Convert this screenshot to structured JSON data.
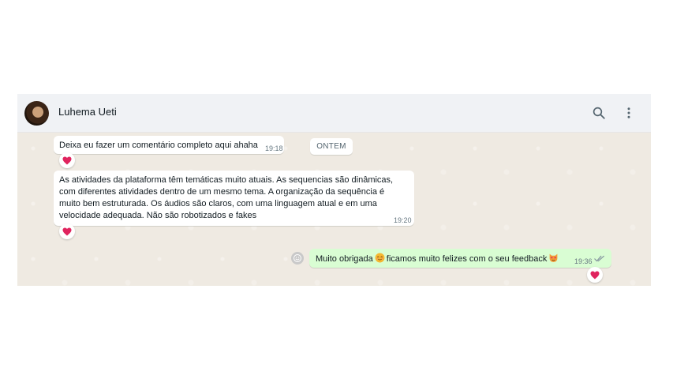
{
  "header": {
    "contact_name": "Luhema Ueti",
    "icons": [
      "search-icon",
      "kebab-menu-icon"
    ]
  },
  "date_divider": "ONTEM",
  "messages": [
    {
      "direction": "incoming",
      "text": "Deixa eu fazer um comentário completo aqui ahaha",
      "time": "19:18",
      "reaction": "heart"
    },
    {
      "direction": "incoming",
      "text": "As atividades da plataforma têm temáticas muito atuais. As sequencias são dinâmicas, com diferentes atividades dentro de um mesmo tema. A organização da sequência é muito bem estruturada. Os áudios são claros, com uma linguagem atual e em uma velocidade adequada. Não são robotizados e fakes",
      "time": "19:20",
      "reaction": "heart"
    },
    {
      "direction": "outgoing",
      "text_part1": "Muito obrigada",
      "text_part2": "ficamos muito felizes com o seu feedback",
      "emoji1": "smiling-face-emoji",
      "emoji2": "heart-eyes-cat-emoji",
      "time": "19:36",
      "status": "read-double-check",
      "reaction": "heart"
    }
  ],
  "colors": {
    "header_bg": "#f0f2f5",
    "chat_bg": "#efeae2",
    "incoming_bubble": "#ffffff",
    "outgoing_bubble": "#d9fdd3",
    "heart": "#e0245e",
    "read_ticks": "#8696a0"
  }
}
